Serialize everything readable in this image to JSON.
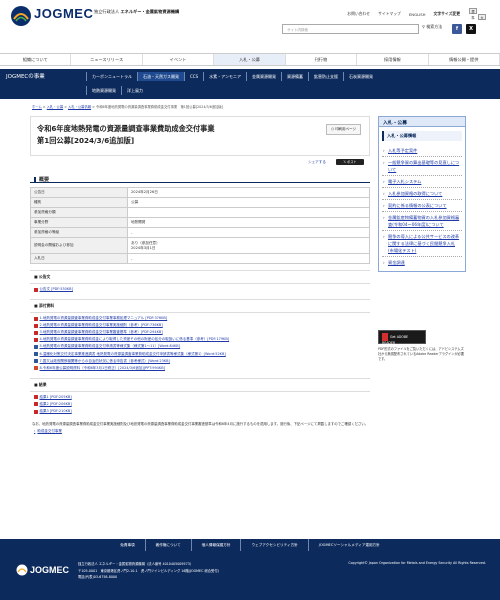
{
  "header": {
    "logo": "JOGMEC",
    "org_prefix": "独立行政法人",
    "org_name": "エネルギー・金属鉱物資源機構",
    "links": [
      "お問い合わせ",
      "サイトマップ",
      "ENGLISH"
    ],
    "font_size_label": "文字サイズ変更",
    "font_sizes": [
      "標準",
      "大"
    ],
    "search_placeholder": "サイト内検索",
    "search_button": "検索方法"
  },
  "gnav": [
    "組織について",
    "ニュースリリース",
    "イベント",
    "入札・公募",
    "刊行物",
    "採用情報",
    "情報公開・提供"
  ],
  "gnav_active": 3,
  "subnav": {
    "title": "JOGMECの事業",
    "row1": [
      "カーボンニュートラル",
      "石油・天然ガス開発",
      "CCS",
      "水素・アンモニア",
      "金属資源開発",
      "資源備蓄",
      "鉱害防止支援",
      "石炭資源開発"
    ],
    "row1_active": 1,
    "row2": [
      "地熱資源開発",
      "洋上風力"
    ]
  },
  "breadcrumb": [
    "ホーム",
    "入札・公募",
    "入札・公募情報",
    "令和6年度地熱発電の資源量調査事業費助成金交付事業　第1回公募[2024/3/6追加版]"
  ],
  "page": {
    "title_line1": "令和6年度地熱発電の資源量調査事業費助成金交付事業",
    "title_line2": "第1回公募[2024/3/6追加版]",
    "print_label": "印刷用ページ",
    "share_label": "シェアする",
    "tweet_label": "ポスト"
  },
  "overview": {
    "heading": "概要",
    "rows": [
      {
        "label": "公告日",
        "value": "2024年2月26日"
      },
      {
        "label": "種別",
        "value": "公募"
      },
      {
        "label": "参加資格分類",
        "value": ""
      },
      {
        "label": "事業分野",
        "value": "地熱開発"
      },
      {
        "label": "参加資格の等級",
        "value": "-"
      },
      {
        "label": "説明会の開催および参加",
        "value": "あり（参加任意）\n2024年3月1日"
      },
      {
        "label": "入札日",
        "value": "-"
      }
    ]
  },
  "announcement": {
    "heading": "公告文",
    "files": [
      {
        "type": "pdf",
        "label": "公告文 [PDF:530KB]"
      }
    ]
  },
  "attachments": {
    "heading": "添付資料",
    "files": [
      {
        "type": "pdf",
        "label": "1.地熱発電の資源量調査事業費助成金交付事業事務処理マニュアル [PDF:376KB]"
      },
      {
        "type": "pdf",
        "label": "2.地熱発電の資源量調査事業費助成金交付事業実施細則（参考）[PDF:736KB]"
      },
      {
        "type": "pdf",
        "label": "3.地熱発電の資源量調査事業費助成金交付事業審査基準（参考）[PDF:294KB]"
      },
      {
        "type": "pdf",
        "label": "4.地熱発電の資源量調査事業費助成金により取得した資産その他の財産の処分の取扱いに係る基準（参考）[PDF:179KB]"
      },
      {
        "type": "word",
        "label": "5.地熱発電の資源量調査事業費助成金交付申請書等様式集（様式第1～11）[Word:84KB]"
      },
      {
        "type": "word",
        "label": "6.温暖化対策交付決定事業推進調書 地熱発電の資源量調査事業費助成金交付申請書等様式集（様式第1）[Word:52KB]"
      },
      {
        "type": "word",
        "label": "7.国又は政府関係機関等からの自治的状況に係る申告書（参考様式）[Word:23KB]"
      },
      {
        "type": "ppt",
        "label": "8.令和6年度公募説明資料（令和6年3月1日修正）[2024/3/6追加][PPT:994KB]"
      }
    ]
  },
  "results": {
    "heading": "結果",
    "files": [
      {
        "type": "pdf",
        "label": "結果1 [PDF:205KB]"
      },
      {
        "type": "pdf",
        "label": "結果2 [PDF:206KB]"
      },
      {
        "type": "pdf",
        "label": "結果3 [PDF:210KB]"
      }
    ]
  },
  "note": {
    "text": "なお、地熱発電の資源量調査事業費助成金交付事業実施細則及び地熱発電の資源量調査事業費助成金交付事業審査基準は令和6年4月に施行するものを適用します。施行後、下記ページにて掲載しますのでご確認ください。",
    "link": "助成金交付事業"
  },
  "sidebar": {
    "heading": "入札・公募",
    "subheading": "入札・公募情報",
    "items": [
      "入札等予定案件",
      "一般競争資の算出基礎等の見直しについて",
      "電子入札システム",
      "入札参加資格の取得について",
      "契約に係る情報の公表について",
      "金属鉱産物備蓄物資の入札参加資格審査(令和04～06年度)について",
      "競争の導入による公共サービスの改革に関する法律に基づく民間競争入札(市場化テスト)",
      "資金調達"
    ]
  },
  "adobe": {
    "badge": "Get ADOBE READER",
    "text": "PDF形式のファイルをご覧いただくには、アドビシステムズ社から無償配布されているAdobe Readerプラグインが必要です。"
  },
  "footer": {
    "nav": [
      "免責事項",
      "著作権について",
      "個人情報保護方針",
      "ウェブアクセシビリティ方針",
      "JOGMECソーシャルメディア運用方針"
    ],
    "logo": "JOGMEC",
    "addr_line1": "独立行政法人 エネルギー・金属鉱物資源機構（法人番号 4010405009573）",
    "addr_line2": "〒105-0001　東京都港区虎ノ門2-10-1　虎ノ門ツインビルディング 16階(JOGMEC 総合受付)",
    "addr_line3": "電話(代表)03-6758-8000",
    "copyright": "Copyright© Japan Organization for Metals and Energy Security All Rights Reserved."
  }
}
